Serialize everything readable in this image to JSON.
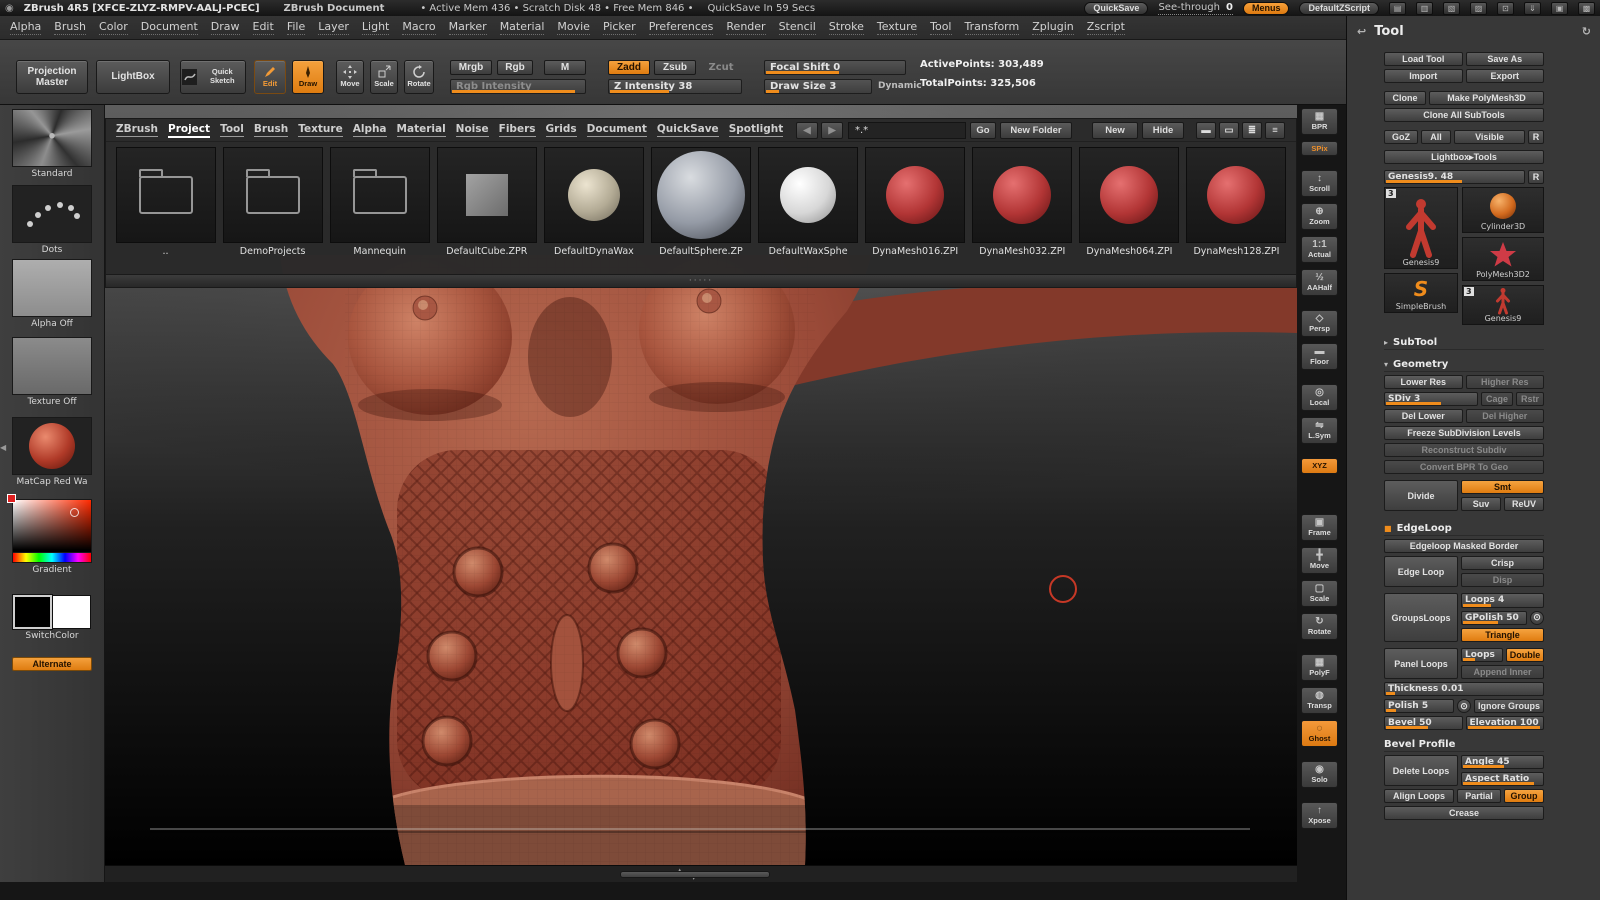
{
  "colors": {
    "accent": "#ee8b24",
    "skin": "#9c4c3a"
  },
  "icons": {
    "logo": "◉",
    "titlebar": [
      "▤",
      "▥",
      "▧",
      "▨",
      "⊡",
      "⇓",
      "▣",
      "▩"
    ],
    "nav_back": "◀",
    "nav_forward": "▶",
    "view_icons": [
      "▬",
      "▭",
      "≣",
      "≡"
    ],
    "tool_dock": "↩",
    "tool_refresh": "↻",
    "toggle_circle": "⊙",
    "section_open": "▾",
    "section_closed": "▸",
    "edgeloop_bullet": "■",
    "grip_dots": "·····",
    "scroll_up": "▲",
    "scroll_down": "▼",
    "tray_collapse": "◀",
    "simplebrush_glyph": "S"
  },
  "titlebar": {
    "app_title": "ZBrush 4R5 [XFCE-ZLYZ-RMPV-AALJ-PCEC]",
    "doc_title": "ZBrush Document",
    "status": "• Active Mem 436 • Scratch Disk 48 • Free Mem 846 •",
    "quicksave_countdown": "QuickSave In 59 Secs",
    "quicksave": "QuickSave",
    "seethrough_label": "See-through",
    "seethrough_value": "0",
    "menus": "Menus",
    "zscript": "DefaultZScript"
  },
  "menubar": {
    "items": [
      "Alpha",
      "Brush",
      "Color",
      "Document",
      "Draw",
      "Edit",
      "File",
      "Layer",
      "Light",
      "Macro",
      "Marker",
      "Material",
      "Movie",
      "Picker",
      "Preferences",
      "Render",
      "Stencil",
      "Stroke",
      "Texture",
      "Tool",
      "Transform",
      "Zplugin",
      "Zscript"
    ]
  },
  "shelf": {
    "projection_master": "Projection Master",
    "lightbox": "LightBox",
    "quick_sketch": "Quick Sketch",
    "edit": "Edit",
    "draw": "Draw",
    "move": "Move",
    "scale": "Scale",
    "rotate": "Rotate",
    "mrgb": "Mrgb",
    "rgb": "Rgb",
    "m": "M",
    "zadd": "Zadd",
    "zsub": "Zsub",
    "zcut": "Zcut",
    "rgb_intensity": "Rgb Intensity",
    "z_intensity": "Z Intensity 38",
    "focal_shift": "Focal Shift 0",
    "draw_size": "Draw Size 3",
    "dynamic": "Dynamic",
    "active_points": "ActivePoints: 303,489",
    "total_points": "TotalPoints: 325,506"
  },
  "lightbox": {
    "tabs": [
      "ZBrush",
      "Project",
      "Tool",
      "Brush",
      "Texture",
      "Alpha",
      "Material",
      "Noise",
      "Fibers",
      "Grids",
      "Document",
      "QuickSave",
      "Spotlight"
    ],
    "active_tab": "Project",
    "search_value": "*.*",
    "go": "Go",
    "new_folder": "New Folder",
    "new": "New",
    "hide": "Hide",
    "items": [
      {
        "label": ".."
      },
      {
        "label": "DemoProjects"
      },
      {
        "label": "Mannequin"
      },
      {
        "label": "DefaultCube.ZPR"
      },
      {
        "label": "DefaultDynaWax"
      },
      {
        "label": "DefaultSphere.ZP"
      },
      {
        "label": "DefaultWaxSphe"
      },
      {
        "label": "DynaMesh016.ZPI"
      },
      {
        "label": "DynaMesh032.ZPI"
      },
      {
        "label": "DynaMesh064.ZPI"
      },
      {
        "label": "DynaMesh128.ZPI"
      }
    ]
  },
  "left_tray": {
    "brush": "Standard",
    "stroke": "Dots",
    "alpha": "Alpha Off",
    "texture": "Texture Off",
    "material": "MatCap Red Wa",
    "gradient": "Gradient",
    "switch": "SwitchColor",
    "alternate": "Alternate"
  },
  "right_shelf": {
    "items": [
      {
        "label": "BPR",
        "glyph": "▦"
      },
      {
        "label": "SPix",
        "glyph": ""
      },
      {
        "label": "Scroll",
        "glyph": "↕"
      },
      {
        "label": "Zoom",
        "glyph": "⊕"
      },
      {
        "label": "Actual",
        "glyph": "1:1"
      },
      {
        "label": "AAHalf",
        "glyph": "½"
      },
      {
        "label": "Persp",
        "glyph": "◇"
      },
      {
        "label": "Floor",
        "glyph": "▬"
      },
      {
        "label": "Local",
        "glyph": "◎"
      },
      {
        "label": "L.Sym",
        "glyph": "⇋"
      },
      {
        "label": "XYZ",
        "glyph": ""
      },
      {
        "label": "Frame",
        "glyph": "▣"
      },
      {
        "label": "Move",
        "glyph": "╋"
      },
      {
        "label": "Scale",
        "glyph": "▢"
      },
      {
        "label": "Rotate",
        "glyph": "↻"
      },
      {
        "label": "PolyF",
        "glyph": "▦"
      },
      {
        "label": "Transp",
        "glyph": "◍"
      },
      {
        "label": "Ghost",
        "glyph": "◌"
      },
      {
        "label": "Solo",
        "glyph": "◉"
      },
      {
        "label": "Xpose",
        "glyph": "↑"
      }
    ]
  },
  "tool": {
    "title": "Tool",
    "load_tool": "Load Tool",
    "save_as": "Save As",
    "import": "Import",
    "export": "Export",
    "clone": "Clone",
    "make_polymesh": "Make PolyMesh3D",
    "clone_all": "Clone All SubTools",
    "goz": "GoZ",
    "all": "All",
    "visible": "Visible",
    "r": "R",
    "lightbox_tools": "Lightbox▸Tools",
    "active_tool": "Genesis9. 48",
    "thumbs": {
      "big_label": "Genesis9",
      "big_badge": "3",
      "cylinder": "Cylinder3D",
      "polymesh": "PolyMesh3D2",
      "simplebrush": "SimpleBrush",
      "genesis_small": "Genesis9",
      "small_badge": "3"
    },
    "subtool": "SubTool",
    "geometry": "Geometry",
    "lower_res": "Lower Res",
    "higher_res": "Higher Res",
    "sdiv": "SDiv 3",
    "cage": "Cage",
    "rstr": "Rstr",
    "del_lower": "Del Lower",
    "del_higher": "Del Higher",
    "freeze": "Freeze SubDivision Levels",
    "reconstruct": "Reconstruct Subdiv",
    "convert_bpr": "Convert BPR To Geo",
    "divide": "Divide",
    "smt": "Smt",
    "suv": "Suv",
    "reuv": "ReUV",
    "edgeloop": "EdgeLoop",
    "edgeloop_masked": "Edgeloop Masked Border",
    "edge_loop": "Edge Loop",
    "crisp": "Crisp",
    "disp": "Disp",
    "groupsloops": "GroupsLoops",
    "loops4": "Loops 4",
    "gpolish": "GPolish 50",
    "triangle": "Triangle",
    "panel_loops": "Panel Loops",
    "loops": "Loops",
    "double": "Double",
    "append_inner": "Append Inner",
    "thickness": "Thickness 0.01",
    "polish": "Polish 5",
    "ignore_groups": "Ignore Groups",
    "bevel": "Bevel 50",
    "elevation": "Elevation 100",
    "bevel_profile": "Bevel Profile",
    "delete_loops": "Delete Loops",
    "angle": "Angle 45",
    "aspect_ratio": "Aspect Ratio",
    "align_loops": "Align Loops",
    "partial": "Partial",
    "group": "Group",
    "crease": "Crease"
  }
}
